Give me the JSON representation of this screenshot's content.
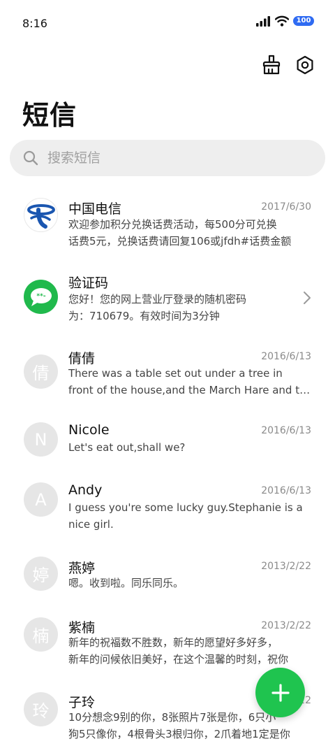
{
  "status_bar": {
    "time": "8:16",
    "battery": "100"
  },
  "toolbar": {
    "clean_icon": "broom-icon",
    "settings_icon": "gear-icon"
  },
  "page": {
    "title": "短信"
  },
  "search": {
    "placeholder": "搜索短信",
    "value": ""
  },
  "conversations": [
    {
      "name": "中国电信",
      "date": "2017/6/30",
      "avatar": "china-telecom-logo",
      "line1": "欢迎参加积分兑换话费活动，每500分可兑换",
      "line2": "话费5元，兑换话费请回复106或jfdh#话费金额"
    },
    {
      "name": "验证码",
      "date": "",
      "avatar": "sms-bubble-icon",
      "line1": "您好！您的网上营业厅登录的随机密码",
      "line2": "为：710679。有效时间为3分钟"
    },
    {
      "name": "倩倩",
      "date": "2016/6/13",
      "avatar": "倩",
      "line1": "There was a table set out under a tree in",
      "line2": "front of the house,and the March Hare and the Hatter"
    },
    {
      "name": "Nicole",
      "date": "2016/6/13",
      "avatar": "N",
      "line1": "Let's eat out,shall we?",
      "line2": ""
    },
    {
      "name": "Andy",
      "date": "2016/6/13",
      "avatar": "A",
      "line1": "I guess you're some lucky guy.Stephanie is a",
      "line2": "nice girl."
    },
    {
      "name": "燕婷",
      "date": "2013/2/22",
      "avatar": "婷",
      "line1": "嗯。收到啦。同乐同乐。",
      "line2": ""
    },
    {
      "name": "紫楠",
      "date": "2013/2/22",
      "avatar": "楠",
      "line1": "新年的祝福数不胜数，新年的愿望好多好多，",
      "line2": "新年的问候依旧美好，在这个温馨的时刻，祝你"
    },
    {
      "name": "子玲",
      "date": "2013/2/22",
      "avatar": "玲",
      "line1": "10分想念9别的你，8张照片7张是你，6只小",
      "line2": "狗5只像你，4根骨头3根归你，2爪着地1定是你"
    }
  ],
  "fab": {
    "icon": "plus-icon"
  },
  "colors": {
    "accent": "#1fc44f",
    "telecom_blue": "#1a56b0",
    "battery_blue": "#2f6bf2"
  }
}
